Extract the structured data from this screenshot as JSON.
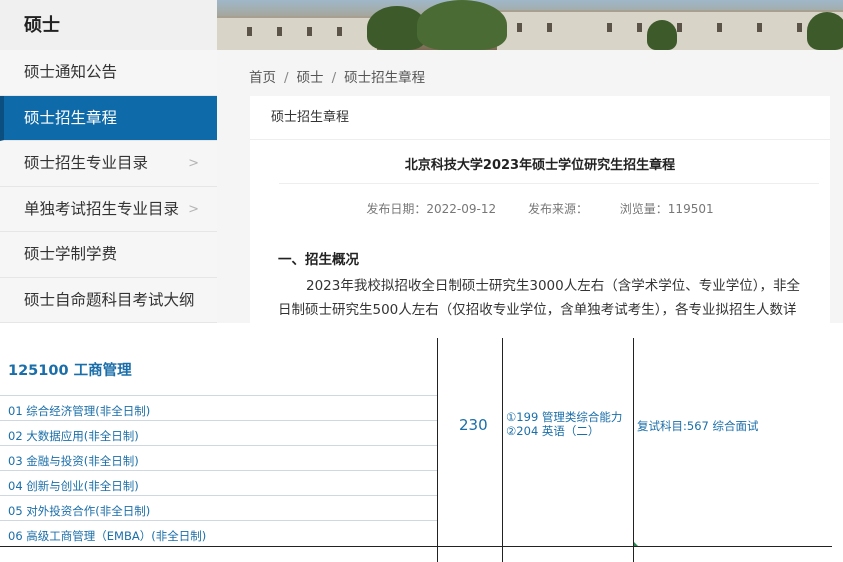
{
  "sidebar": {
    "title": "硕士",
    "items": [
      {
        "label": "硕士通知公告",
        "chevron": ""
      },
      {
        "label": "硕士招生章程",
        "chevron": "",
        "active": true
      },
      {
        "label": "硕士招生专业目录",
        "chevron": ">"
      },
      {
        "label": "单独考试招生专业目录",
        "chevron": ">"
      },
      {
        "label": "硕士学制学费",
        "chevron": ""
      },
      {
        "label": "硕士自命题科目考试大纲",
        "chevron": ""
      }
    ]
  },
  "breadcrumb": {
    "home": "首页",
    "sep": "/",
    "level1": "硕士",
    "level2": "硕士招生章程"
  },
  "card": {
    "header": "硕士招生章程",
    "title": "北京科技大学2023年硕士学位研究生招生章程",
    "publish_date": "发布日期：2022-09-12",
    "source": "发布来源：",
    "views": "浏览量：119501",
    "section_heading": "一、招生概况",
    "paragraph": "2023年我校拟招收全日制硕士研究生3000人左右（含学术学位、专业学位），非全日制硕士研究生500人左右（仅招收专业学位，含单独考试考生），各专业拟招生人数详见"
  },
  "table": {
    "major": "125100 工商管理",
    "directions": [
      "01 综合经济管理(非全日制)",
      "02 大数据应用(非全日制)",
      "03 金融与投资(非全日制)",
      "04 创新与创业(非全日制)",
      "05 对外投资合作(非全日制)",
      "06 高级工商管理（EMBA）(非全日制)"
    ],
    "quota": "230",
    "subject1": "①199 管理类综合能力",
    "subject2": "②204 英语（二）",
    "retest": "复试科目:567 综合面试"
  },
  "colors": {
    "active_bg": "#0e6aa8",
    "link_blue": "#1a6ea9"
  }
}
